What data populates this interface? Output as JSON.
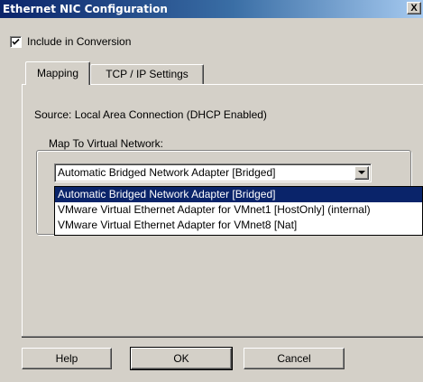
{
  "window": {
    "title": "Ethernet NIC Configuration",
    "close_label": "X"
  },
  "include_checkbox": {
    "label": "Include in Conversion",
    "checked": true
  },
  "tabs": [
    {
      "label": "Mapping",
      "active": true
    },
    {
      "label": "TCP / IP Settings",
      "active": false
    }
  ],
  "source_text": "Source:  Local Area Connection (DHCP Enabled)",
  "map_group": {
    "label": "Map To Virtual Network:",
    "selected": "Automatic Bridged Network Adapter [Bridged]",
    "options": [
      "Automatic Bridged Network Adapter [Bridged]",
      "VMware Virtual Ethernet Adapter for VMnet1 [HostOnly] (internal)",
      "VMware Virtual Ethernet Adapter for VMnet8 [Nat]"
    ],
    "highlighted_index": 0
  },
  "buttons": {
    "help": "Help",
    "ok": "OK",
    "cancel": "Cancel"
  },
  "colors": {
    "dialog_bg": "#d4d0c8",
    "title_bg": "#0a246a",
    "selection_bg": "#0a246a"
  },
  "icons": {
    "checkbox": "checkmark-icon",
    "dropdown": "dropdown-arrow-icon",
    "close": "close-icon"
  }
}
